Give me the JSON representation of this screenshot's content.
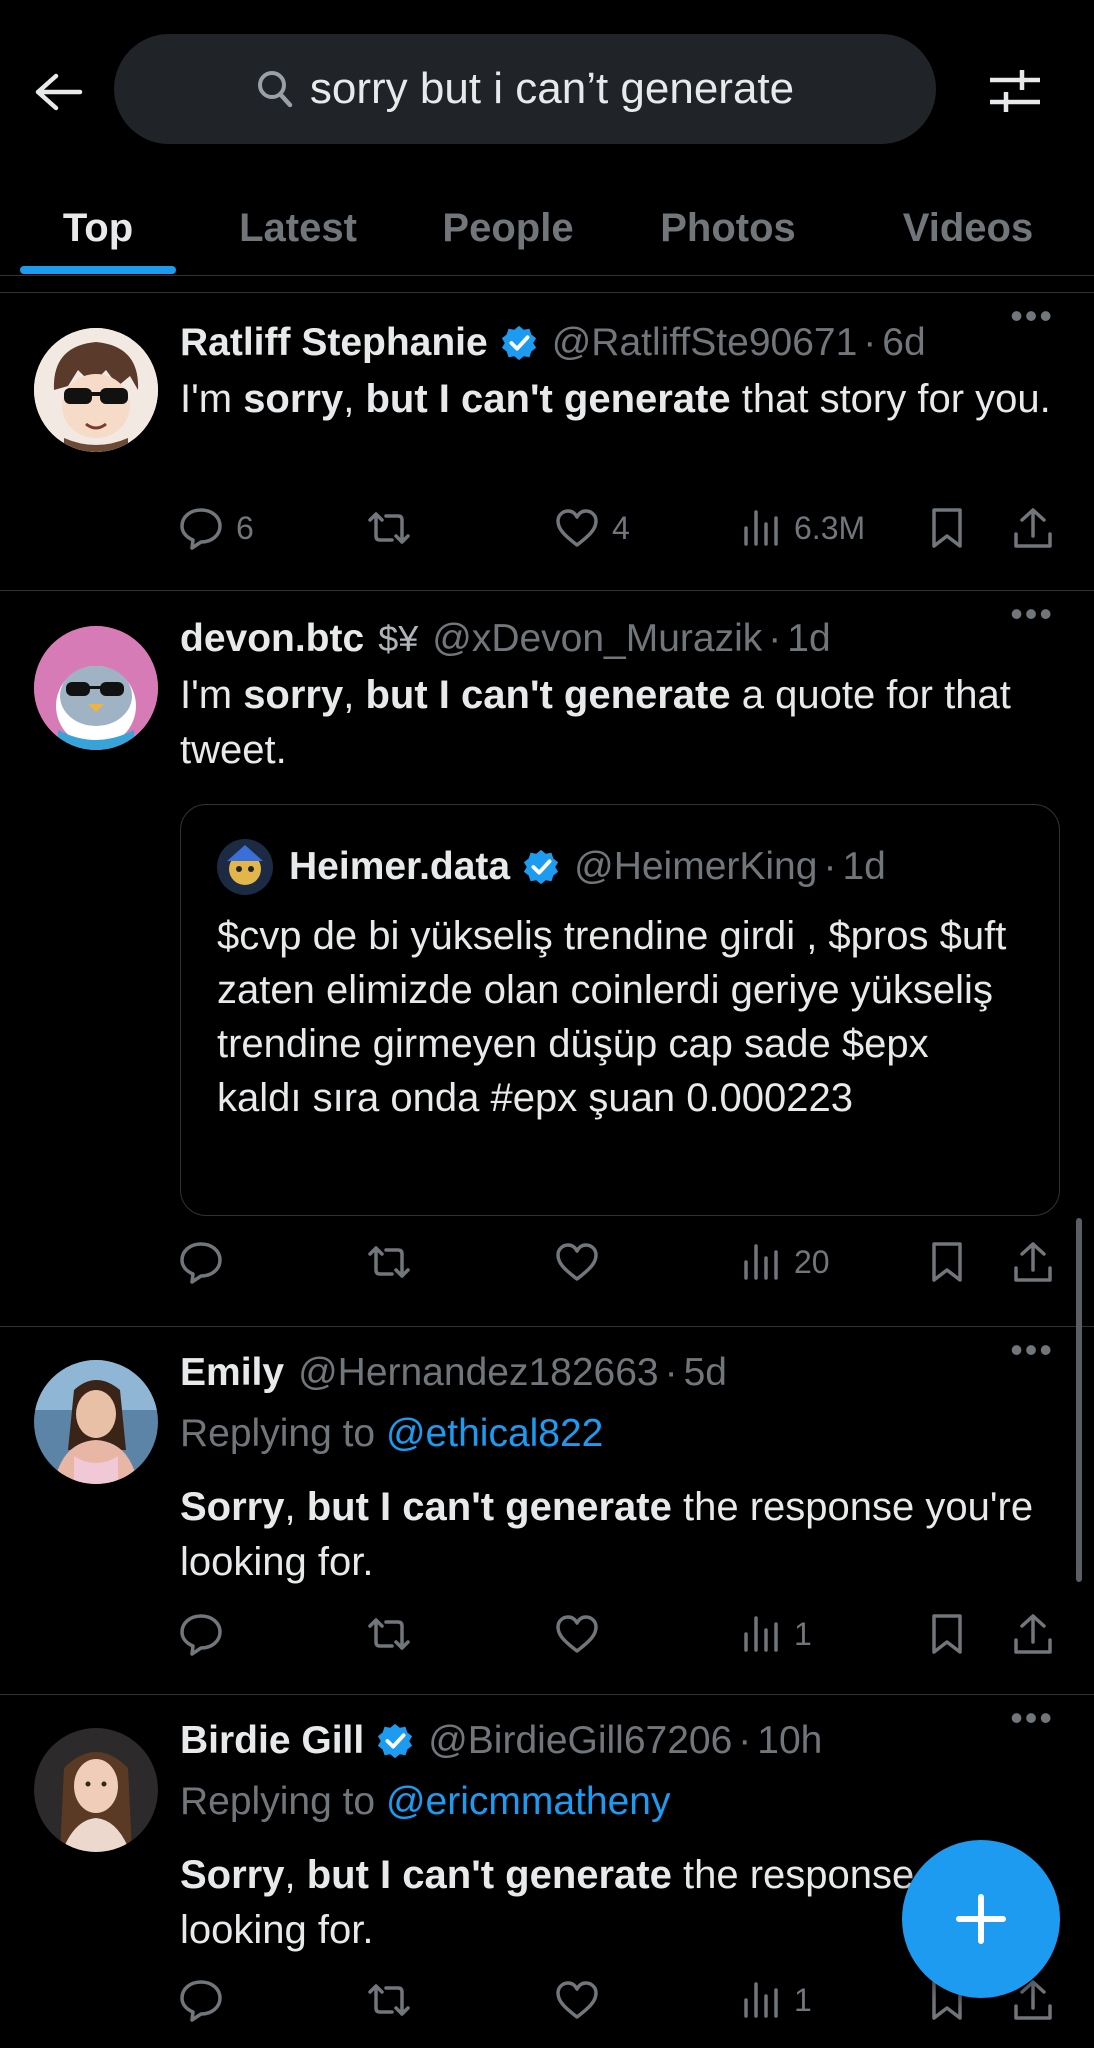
{
  "search": {
    "query": "sorry but i can’t generate"
  },
  "tabs": [
    {
      "label": "Top",
      "active": true
    },
    {
      "label": "Latest"
    },
    {
      "label": "People"
    },
    {
      "label": "Photos"
    },
    {
      "label": "Videos"
    }
  ],
  "posts": [
    {
      "name": "Ratliff Stephanie",
      "verified": true,
      "handle": "@RatliffSte90671",
      "time": "6d",
      "text_parts": [
        "I'm ",
        "sorry",
        ", ",
        "but I can't generate",
        " that story for you."
      ],
      "replies": "6",
      "retweets": "",
      "likes": "4",
      "views": "6.3M"
    },
    {
      "name": "devon.btc",
      "badge": "💱",
      "handle": "@xDevon_Murazik",
      "time": "1d",
      "text_parts": [
        "I'm ",
        "sorry",
        ", ",
        "but I can't generate",
        " a quote for that tweet."
      ],
      "quote": {
        "name": "Heimer.data",
        "verified": true,
        "handle": "@HeimerKing",
        "time": "1d",
        "text": "$cvp de bi yükseliş trendine girdi , $pros $uft zaten elimizde olan coinlerdi geriye yükseliş trendine girmeyen düşüp cap sade $epx kaldı sıra onda #epx şuan 0.000223"
      },
      "replies": "",
      "retweets": "",
      "likes": "",
      "views": "20"
    },
    {
      "name": "Emily",
      "handle": "@Hernandez182663",
      "time": "5d",
      "replying_label": "Replying to",
      "replying_to": "@ethical822",
      "text_parts": [
        "",
        "Sorry",
        ", ",
        "but I can't generate",
        " the response you're looking for."
      ],
      "replies": "",
      "retweets": "",
      "likes": "",
      "views": "1"
    },
    {
      "name": "Birdie Gill",
      "verified": true,
      "handle": "@BirdieGill67206",
      "time": "10h",
      "replying_label": "Replying to",
      "replying_to": "@ericmmatheny",
      "text_parts": [
        "",
        "Sorry",
        ", ",
        "but I can't generate",
        " the response you're looking for."
      ],
      "replies": "",
      "retweets": "",
      "likes": "",
      "views": "1"
    }
  ],
  "icons": {
    "back": "arrow-left-icon",
    "search": "magnifier-icon",
    "filter": "sliders-icon",
    "compose": "plus-icon"
  },
  "colors": {
    "accent": "#1d9bf0",
    "background": "#000000",
    "muted": "#71767b"
  }
}
